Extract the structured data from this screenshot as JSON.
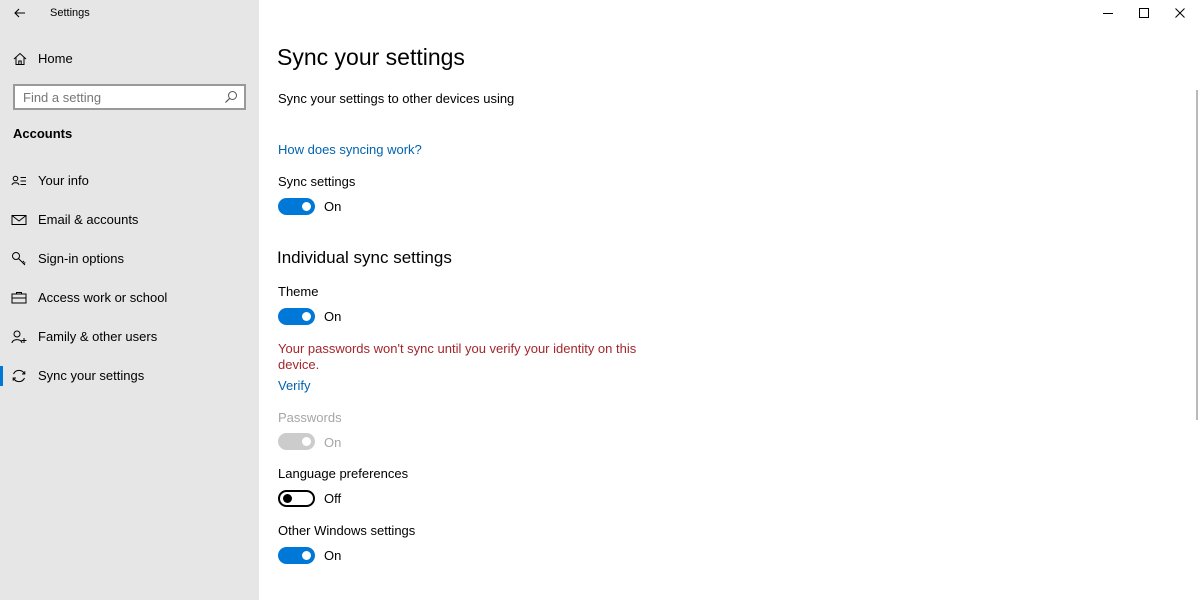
{
  "window": {
    "title": "Settings",
    "minimize_icon": "minimize-icon",
    "maximize_icon": "maximize-icon",
    "close_icon": "close-icon"
  },
  "sidebar": {
    "home_label": "Home",
    "search_placeholder": "Find a setting",
    "section": "Accounts",
    "items": [
      {
        "label": "Your info",
        "icon": "contact-card-icon"
      },
      {
        "label": "Email & accounts",
        "icon": "mail-icon"
      },
      {
        "label": "Sign-in options",
        "icon": "key-icon"
      },
      {
        "label": "Access work or school",
        "icon": "briefcase-icon"
      },
      {
        "label": "Family & other users",
        "icon": "add-user-icon"
      },
      {
        "label": "Sync your settings",
        "icon": "sync-icon",
        "selected": true
      }
    ]
  },
  "main": {
    "title": "Sync your settings",
    "description": "Sync your settings to other devices using",
    "how_link": "How does syncing work?",
    "sync_settings": {
      "label": "Sync settings",
      "state": "On",
      "on": true
    },
    "individual_title": "Individual sync settings",
    "theme": {
      "label": "Theme",
      "state": "On",
      "on": true
    },
    "warning": "Your passwords won't sync until you verify your identity on this device.",
    "verify_link": "Verify",
    "passwords": {
      "label": "Passwords",
      "state": "On",
      "on": true,
      "disabled": true
    },
    "language": {
      "label": "Language preferences",
      "state": "Off",
      "on": false
    },
    "other": {
      "label": "Other Windows settings",
      "state": "On",
      "on": true
    }
  },
  "colors": {
    "accent": "#0078d7",
    "link": "#0063b1",
    "warning": "#a4262c",
    "sidebar_bg": "#e6e6e6"
  }
}
